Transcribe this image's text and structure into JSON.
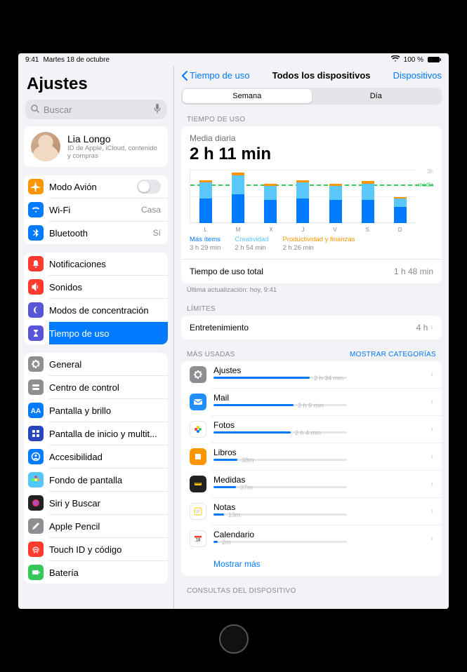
{
  "status": {
    "time": "9:41",
    "date": "Martes 18 de octubre",
    "wifi_pct": "100 %"
  },
  "sidebar": {
    "title": "Ajustes",
    "search_placeholder": "Buscar",
    "account": {
      "name": "Lia Longo",
      "sub": "ID de Apple, iCloud, contenido y compras"
    },
    "groups": [
      {
        "id": "connectivity",
        "items": [
          {
            "id": "airplane",
            "label": "Modo Avión",
            "color": "#ff9500",
            "icon": "airplane",
            "trailing_toggle": true
          },
          {
            "id": "wifi",
            "label": "Wi-Fi",
            "color": "#007aff",
            "icon": "wifi",
            "trailing_text": "Casa"
          },
          {
            "id": "bluetooth",
            "label": "Bluetooth",
            "color": "#007aff",
            "icon": "bluetooth",
            "trailing_text": "Sí"
          }
        ]
      },
      {
        "id": "notifications",
        "items": [
          {
            "id": "notifications",
            "label": "Notificaciones",
            "color": "#ff3b30",
            "icon": "bell"
          },
          {
            "id": "sounds",
            "label": "Sonidos",
            "color": "#ff3b30",
            "icon": "speaker"
          },
          {
            "id": "focus",
            "label": "Modos de concentración",
            "color": "#5856d6",
            "icon": "moon"
          },
          {
            "id": "screentime",
            "label": "Tiempo de uso",
            "color": "#5856d6",
            "icon": "hourglass",
            "active": true
          }
        ]
      },
      {
        "id": "general",
        "items": [
          {
            "id": "general",
            "label": "General",
            "color": "#8e8e93",
            "icon": "gear"
          },
          {
            "id": "control-center",
            "label": "Centro de control",
            "color": "#8e8e93",
            "icon": "switches"
          },
          {
            "id": "display",
            "label": "Pantalla y brillo",
            "color": "#007aff",
            "icon": "text"
          },
          {
            "id": "home-screen",
            "label": "Pantalla de inicio y multit...",
            "color": "#2845bd",
            "icon": "grid"
          },
          {
            "id": "accessibility",
            "label": "Accesibilidad",
            "color": "#007aff",
            "icon": "person"
          },
          {
            "id": "wallpaper",
            "label": "Fondo de pantalla",
            "color": "#54c8fa",
            "icon": "flower"
          },
          {
            "id": "siri",
            "label": "Siri y Buscar",
            "color": "#222222",
            "icon": "siri"
          },
          {
            "id": "apple-pencil",
            "label": "Apple Pencil",
            "color": "#8e8e93",
            "icon": "pencil"
          },
          {
            "id": "touchid",
            "label": "Touch ID y código",
            "color": "#ff3b30",
            "icon": "fingerprint"
          },
          {
            "id": "battery",
            "label": "Batería",
            "color": "#34c759",
            "icon": "battery"
          }
        ]
      }
    ]
  },
  "main": {
    "nav": {
      "back": "Tiempo de uso",
      "title": "Todos los dispositivos",
      "right": "Dispositivos"
    },
    "segments": {
      "week": "Semana",
      "day": "Día",
      "active": "week"
    },
    "usage": {
      "section_label": "TIEMPO DE USO",
      "media_label": "Media diaria",
      "media_value": "2 h 11 min",
      "total_label": "Tiempo de uso total",
      "total_value": "1 h 48 min",
      "last_update": "Última actualización: hoy, 9:41",
      "axis_top": "3h",
      "axis_media": "media",
      "categories": [
        {
          "label": "Más ítems",
          "value": "3 h 29 min",
          "color": "#007aff"
        },
        {
          "label": "Creatividad",
          "value": "2 h 54 min",
          "color": "#5ac8fa"
        },
        {
          "label": "Productividad y finanzas",
          "value": "2 h 26 min",
          "color": "#ff9500"
        }
      ]
    },
    "limits": {
      "section_label": "LÍMITES",
      "items": [
        {
          "label": "Entretenimiento",
          "value": "4 h"
        }
      ]
    },
    "most_used": {
      "section_label": "MÁS USADAS",
      "link": "MOSTRAR CATEGORÍAS",
      "show_more": "Mostrar más",
      "apps": [
        {
          "name": "Ajustes",
          "time": "2 h 34 min",
          "frac": 0.72,
          "color": "#8e8e93",
          "icon": "gear"
        },
        {
          "name": "Mail",
          "time": "2 h 9 min",
          "frac": 0.6,
          "color": "#1f8fff",
          "icon": "mail"
        },
        {
          "name": "Fotos",
          "time": "2 h 4 min",
          "frac": 0.58,
          "color": "#ffffff",
          "icon": "photos",
          "border": true
        },
        {
          "name": "Libros",
          "time": "38m",
          "frac": 0.18,
          "color": "#ff9500",
          "icon": "book"
        },
        {
          "name": "Medidas",
          "time": "37m",
          "frac": 0.17,
          "color": "#222222",
          "icon": "ruler"
        },
        {
          "name": "Notas",
          "time": "13m",
          "frac": 0.08,
          "color": "#ffffff",
          "icon": "notes",
          "border": true
        },
        {
          "name": "Calendario",
          "time": "2m",
          "frac": 0.03,
          "color": "#ffffff",
          "icon": "calendar",
          "border": true
        }
      ]
    },
    "device_section_label": "CONSULTAS DEL DISPOSITIVO"
  },
  "chart_data": {
    "type": "bar",
    "title": "Media diaria 2 h 11 min",
    "xlabel": "",
    "ylabel": "horas",
    "ylim": [
      0,
      3
    ],
    "media_line": 2.18,
    "categories": [
      "L",
      "M",
      "X",
      "J",
      "V",
      "S",
      "D"
    ],
    "series": [
      {
        "name": "Más ítems",
        "color": "#007aff",
        "values": [
          1.4,
          1.6,
          1.3,
          1.4,
          1.3,
          1.3,
          0.9
        ]
      },
      {
        "name": "Creatividad",
        "color": "#5ac8fa",
        "values": [
          0.9,
          1.1,
          0.8,
          0.9,
          0.8,
          0.9,
          0.5
        ]
      },
      {
        "name": "Productividad y finanzas",
        "color": "#ff9500",
        "values": [
          0.1,
          0.15,
          0.1,
          0.12,
          0.1,
          0.15,
          0.05
        ]
      }
    ]
  }
}
